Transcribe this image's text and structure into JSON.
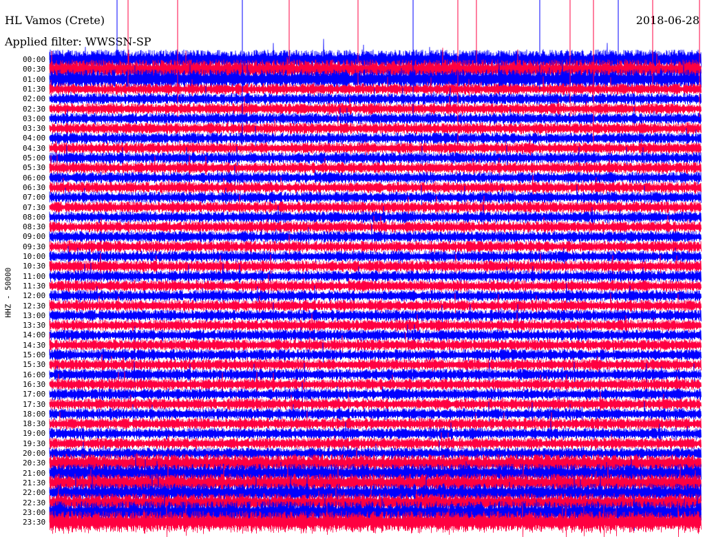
{
  "header": {
    "station": "HL Vamos (Crete)",
    "date": "2018-06-28",
    "filter": "Applied filter: WWSSN-SP"
  },
  "chart_data": {
    "type": "helicorder",
    "title": "HL Vamos (Crete)",
    "date": "2018-06-28",
    "channel_label": "HHZ - 50000",
    "row_labels": [
      "00:00",
      "00:30",
      "01:00",
      "01:30",
      "02:00",
      "02:30",
      "03:00",
      "03:30",
      "04:00",
      "04:30",
      "05:00",
      "05:30",
      "06:00",
      "06:30",
      "07:00",
      "07:30",
      "08:00",
      "08:30",
      "09:00",
      "09:30",
      "10:00",
      "10:30",
      "11:00",
      "11:30",
      "12:00",
      "12:30",
      "13:00",
      "13:30",
      "14:00",
      "14:30",
      "15:00",
      "15:30",
      "16:00",
      "16:30",
      "17:00",
      "17:30",
      "18:00",
      "18:30",
      "19:00",
      "19:30",
      "20:00",
      "20:30",
      "21:00",
      "21:30",
      "22:00",
      "22:30",
      "23:00",
      "23:30"
    ],
    "row_minutes": 30,
    "trace_colors": [
      "#0000ff",
      "#ff0040"
    ],
    "grid": false
  }
}
